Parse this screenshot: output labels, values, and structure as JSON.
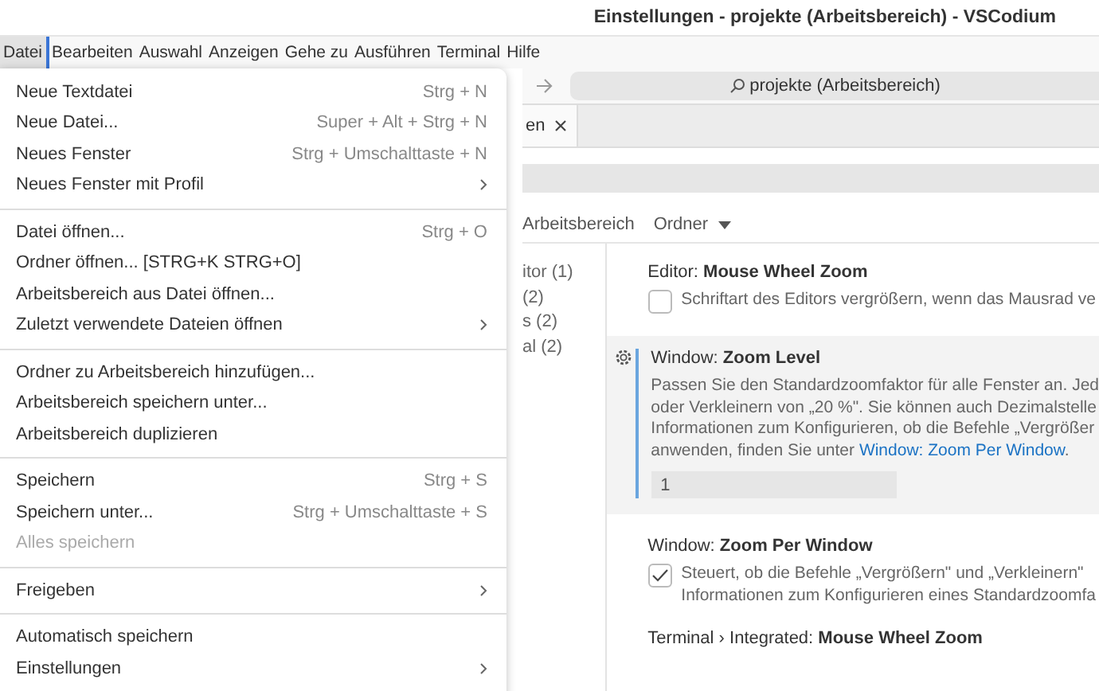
{
  "window": {
    "title": "Einstellungen - projekte (Arbeitsbereich) - VSCodium"
  },
  "menubar": [
    {
      "label": "Datei",
      "selected": true
    },
    {
      "label": "Bearbeiten",
      "selected": false
    },
    {
      "label": "Auswahl",
      "selected": false
    },
    {
      "label": "Anzeigen",
      "selected": false
    },
    {
      "label": "Gehe zu",
      "selected": false
    },
    {
      "label": "Ausführen",
      "selected": false
    },
    {
      "label": "Terminal",
      "selected": false
    },
    {
      "label": "Hilfe",
      "selected": false
    }
  ],
  "file_menu": [
    [
      {
        "label": "Neue Textdatei",
        "shortcut": "Strg + N",
        "submenu": false,
        "disabled": false
      },
      {
        "label": "Neue Datei...",
        "shortcut": "Super + Alt + Strg + N",
        "submenu": false,
        "disabled": false
      },
      {
        "label": "Neues Fenster",
        "shortcut": "Strg + Umschalttaste + N",
        "submenu": false,
        "disabled": false
      },
      {
        "label": "Neues Fenster mit Profil",
        "submenu": true,
        "disabled": false
      }
    ],
    [
      {
        "label": "Datei öffnen...",
        "shortcut": "Strg + O",
        "submenu": false,
        "disabled": false
      },
      {
        "label": "Ordner öffnen... [STRG+K STRG+O]",
        "submenu": false,
        "disabled": false
      },
      {
        "label": "Arbeitsbereich aus Datei öffnen...",
        "submenu": false,
        "disabled": false
      },
      {
        "label": "Zuletzt verwendete Dateien öffnen",
        "submenu": true,
        "disabled": false
      }
    ],
    [
      {
        "label": "Ordner zu Arbeitsbereich hinzufügen...",
        "submenu": false,
        "disabled": false
      },
      {
        "label": "Arbeitsbereich speichern unter...",
        "submenu": false,
        "disabled": false
      },
      {
        "label": "Arbeitsbereich duplizieren",
        "submenu": false,
        "disabled": false
      }
    ],
    [
      {
        "label": "Speichern",
        "shortcut": "Strg + S",
        "submenu": false,
        "disabled": false
      },
      {
        "label": "Speichern unter...",
        "shortcut": "Strg + Umschalttaste + S",
        "submenu": false,
        "disabled": false
      },
      {
        "label": "Alles speichern",
        "submenu": false,
        "disabled": true
      }
    ],
    [
      {
        "label": "Freigeben",
        "submenu": true,
        "disabled": false
      }
    ],
    [
      {
        "label": "Automatisch speichern",
        "submenu": false,
        "disabled": false
      },
      {
        "label": "Einstellungen",
        "submenu": true,
        "disabled": false
      }
    ]
  ],
  "command_center": {
    "text": "projekte (Arbeitsbereich)"
  },
  "tabs": [
    {
      "label": "en",
      "selected": true
    }
  ],
  "scope_tabs": [
    {
      "label": "Arbeitsbereich",
      "dropdown": false
    },
    {
      "label": "Ordner",
      "dropdown": true
    }
  ],
  "toc": [
    "itor (1)",
    "(2)",
    "s (2)",
    "al (2)"
  ],
  "settings": [
    {
      "kind": "checkbox",
      "category": "Editor: ",
      "name": "Mouse Wheel Zoom",
      "focused": false,
      "checked": false,
      "description": [
        {
          "text": "Schriftart des Editors vergrößern, wenn das Mausrad ve"
        }
      ]
    },
    {
      "kind": "number",
      "category": "Window: ",
      "name": "Zoom Level",
      "focused": true,
      "value": "1",
      "description": [
        {
          "text": "Passen Sie den Standardzoomfaktor für alle Fenster an. Jed"
        },
        {
          "text": "oder Verkleinern von „20 %\". Sie können auch Dezimalstelle"
        },
        {
          "text": "Informationen zum Konfigurieren, ob die Befehle „Vergrößer"
        },
        {
          "text": "anwenden, finden Sie unter ",
          "link": "Window: Zoom Per Window",
          "after": "."
        }
      ]
    },
    {
      "kind": "checkbox",
      "category": "Window: ",
      "name": "Zoom Per Window",
      "focused": false,
      "checked": true,
      "description": [
        {
          "text": "Steuert, ob die Befehle „Vergrößern\" und „Verkleinern\""
        },
        {
          "text": "Informationen zum Konfigurieren eines Standardzoomfa"
        }
      ]
    },
    {
      "kind": "title",
      "category": "Terminal › Integrated: ",
      "name": "Mouse Wheel Zoom",
      "focused": false
    }
  ]
}
